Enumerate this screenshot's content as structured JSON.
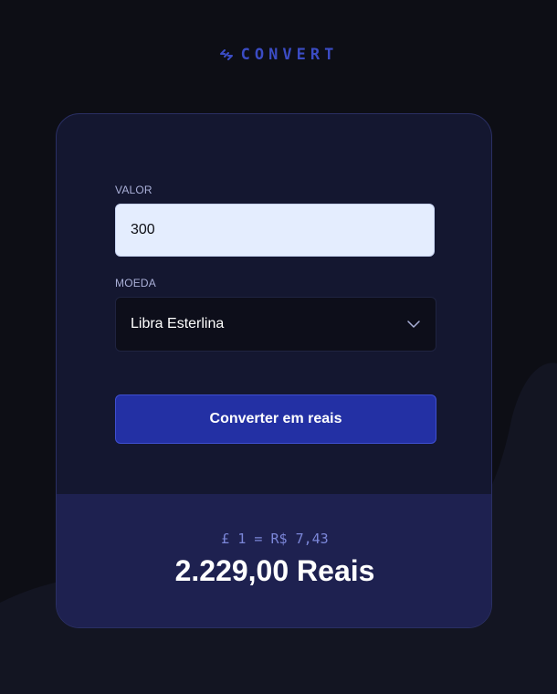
{
  "brand": {
    "name": "CONVERT",
    "icon": "arrows-exchange-icon",
    "color": "#3b4cc4"
  },
  "form": {
    "amount_label": "VALOR",
    "amount_value": "300",
    "currency_label": "MOEDA",
    "currency_selected": "Libra Esterlina",
    "submit_label": "Converter em reais"
  },
  "result": {
    "rate": "£ 1 = R$ 7,43",
    "total": "2.229,00 Reais"
  },
  "colors": {
    "background": "#0d0e15",
    "card": "#141730",
    "result_panel": "#1e2150",
    "button": "#2330a4",
    "input_bg": "#e4edfe"
  }
}
